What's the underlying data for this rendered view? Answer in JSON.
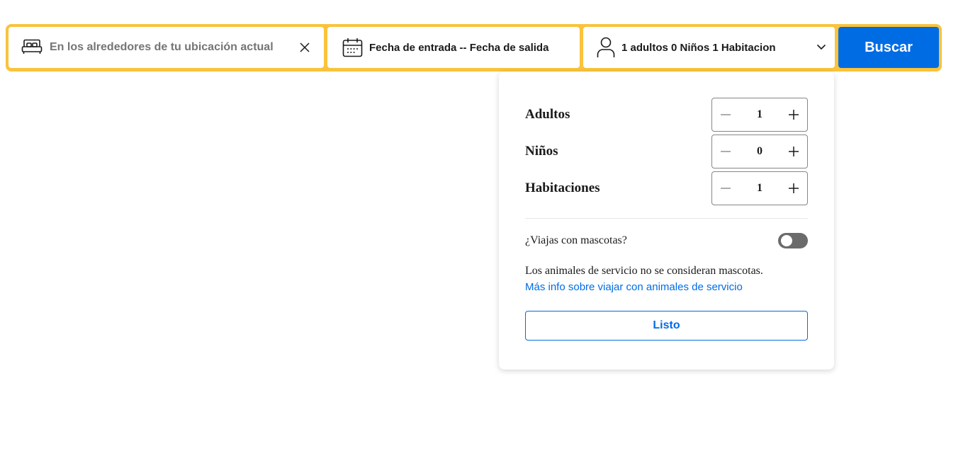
{
  "search": {
    "destination_placeholder": "En los alrededores de tu ubicación actual",
    "destination_value": "En los alrededores de tu ubicación actual",
    "dates_label": "Fecha de entrada -- Fecha de salida",
    "occupancy_label": "1 adultos 0 Niños 1 Habitacion",
    "search_button": "Buscar",
    "accent_color": "#febb02",
    "button_color": "#006ce4"
  },
  "occupancy": {
    "rows": [
      {
        "label": "Adultos",
        "value": "1"
      },
      {
        "label": "Niños",
        "value": "0"
      },
      {
        "label": "Habitaciones",
        "value": "1"
      }
    ],
    "pets_question": "¿Viajas con mascotas?",
    "pets_toggle_on": false,
    "service_animals_note": "Los animales de servicio no se consideran mascotas.",
    "service_animals_link": "Más info sobre viajar con animales de servicio",
    "done_button": "Listo"
  },
  "icons": {
    "destination": "bed-icon",
    "clear": "close-icon",
    "dates": "calendar-icon",
    "occupancy": "person-icon",
    "dropdown": "chevron-down-icon",
    "decrease": "minus-icon",
    "increase": "plus-icon"
  }
}
